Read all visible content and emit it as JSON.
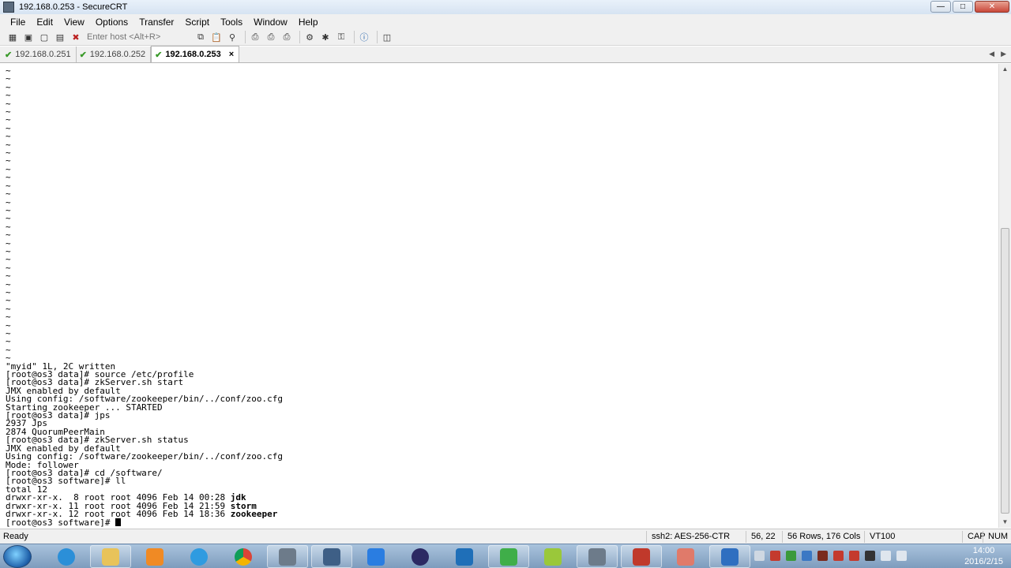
{
  "window": {
    "title": "192.168.0.253 - SecureCRT"
  },
  "menu": [
    "File",
    "Edit",
    "View",
    "Options",
    "Transfer",
    "Script",
    "Tools",
    "Window",
    "Help"
  ],
  "toolbar": {
    "host_placeholder": "Enter host <Alt+R>"
  },
  "tabs": [
    {
      "label": "192.168.0.251",
      "active": false
    },
    {
      "label": "192.168.0.252",
      "active": false
    },
    {
      "label": "192.168.0.253",
      "active": true
    }
  ],
  "terminal": {
    "tilde_lines": 36,
    "lines": [
      {
        "text": "\"myid\" 1L, 2C written"
      },
      {
        "text": "[root@os3 data]# source /etc/profile"
      },
      {
        "text": "[root@os3 data]# zkServer.sh start"
      },
      {
        "text": "JMX enabled by default"
      },
      {
        "text": "Using config: /software/zookeeper/bin/../conf/zoo.cfg"
      },
      {
        "text": "Starting zookeeper ... STARTED"
      },
      {
        "text": "[root@os3 data]# jps"
      },
      {
        "text": "2937 Jps"
      },
      {
        "text": "2874 QuorumPeerMain"
      },
      {
        "text": "[root@os3 data]# zkServer.sh status"
      },
      {
        "text": "JMX enabled by default"
      },
      {
        "text": "Using config: /software/zookeeper/bin/../conf/zoo.cfg"
      },
      {
        "text": "Mode: follower"
      },
      {
        "text": "[root@os3 data]# cd /software/"
      },
      {
        "text": "[root@os3 software]# ll"
      },
      {
        "text": "total 12"
      },
      {
        "text": "drwxr-xr-x.  8 root root 4096 Feb 14 00:28 ",
        "bold": "jdk"
      },
      {
        "text": "drwxr-xr-x. 11 root root 4096 Feb 14 21:59 ",
        "bold": "storm"
      },
      {
        "text": "drwxr-xr-x. 12 root root 4096 Feb 14 18:36 ",
        "bold": "zookeeper"
      }
    ],
    "prompt": "[root@os3 software]# "
  },
  "status": {
    "ready": "Ready",
    "cipher": "ssh2: AES-256-CTR",
    "cursor": "56,  22",
    "size": "56 Rows, 176 Cols",
    "emulation": "VT100",
    "caps": "CAP",
    "num": "NUM"
  },
  "clock": {
    "time": "14:00",
    "date": "2016/2/15"
  },
  "colors": {
    "accent": "#1d5ea8",
    "check": "#3a9a2a"
  }
}
